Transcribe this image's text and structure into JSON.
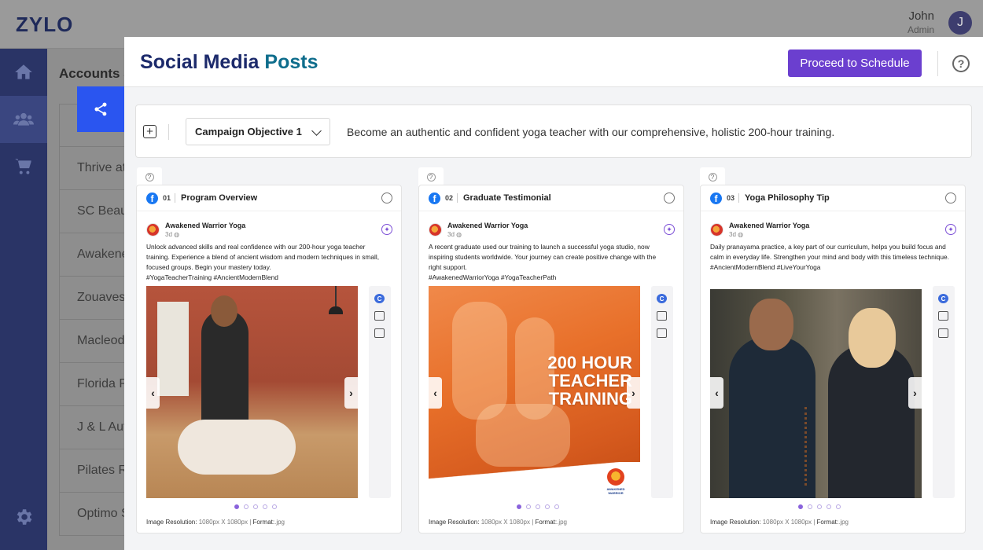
{
  "app": {
    "logo": "ZYLO"
  },
  "user": {
    "name": "John",
    "role": "Admin",
    "initial": "J"
  },
  "nav": [
    "home-icon",
    "users-icon",
    "cart-icon",
    "gear-icon"
  ],
  "background": {
    "heading": "Accounts S",
    "rows": [
      "Thrive at",
      "SC Beaut",
      "Awakene",
      "Zouaves",
      "Macleod",
      "Florida P",
      "J & L Aut",
      "Pilates R",
      "Optimo S"
    ]
  },
  "modal": {
    "title_part1": "Social Media",
    "title_part2": "Posts",
    "proceed_label": "Proceed to Schedule",
    "help_symbol": "?"
  },
  "campaign": {
    "add_symbol": "+",
    "objective_selected": "Campaign Objective 1",
    "objective_text": "Become an authentic and confident yoga teacher with our comprehensive, holistic 200-hour training."
  },
  "cards": [
    {
      "num": "01",
      "title": "Program Overview",
      "brand": "Awakened Warrior Yoga",
      "meta": "3d",
      "caption": "Unlock advanced skills and real confidence with our 200-hour yoga teacher training. Experience a blend of ancient wisdom and modern techniques in small, focused groups. Begin your mastery today.",
      "hashtags": "#YogaTeacherTraining #AncientModernBlend",
      "resolution_label": "Image Resolution:",
      "resolution": "1080px X 1080px",
      "format_label": "Format:",
      "format": ".jpg",
      "active_dot": 0,
      "dot_count": 5
    },
    {
      "num": "02",
      "title": "Graduate Testimonial",
      "brand": "Awakened Warrior Yoga",
      "meta": "3d",
      "caption": "A recent graduate used our training to launch a successful yoga studio, now inspiring students worldwide. Your journey can create positive change with the right support.",
      "hashtags": "#AwakenedWarriorYoga #YogaTeacherPath",
      "image_text": "200 HOUR TEACHER TRAINING",
      "badge_text": "AWAKENED WARRIOR",
      "resolution_label": "Image Resolution:",
      "resolution": "1080px X 1080px",
      "format_label": "Format:",
      "format": ".jpg",
      "active_dot": 0,
      "dot_count": 5
    },
    {
      "num": "03",
      "title": "Yoga Philosophy Tip",
      "brand": "Awakened Warrior Yoga",
      "meta": "3d",
      "caption": "Daily pranayama practice, a key part of our curriculum, helps you build focus and calm in everyday life. Strengthen your mind and body with this timeless technique.",
      "hashtags": "#AncientModernBlend #LiveYourYoga",
      "resolution_label": "Image Resolution:",
      "resolution": "1080px X 1080px",
      "format_label": "Format:",
      "format": ".jpg",
      "active_dot": 0,
      "dot_count": 5
    }
  ],
  "colors": {
    "accent": "#6b3fcf",
    "title_dark": "#1c2a6b",
    "title_teal": "#0e6d8c",
    "sidebar": "#2a3466",
    "share_tab": "#2a55f0",
    "facebook": "#1877f2"
  }
}
